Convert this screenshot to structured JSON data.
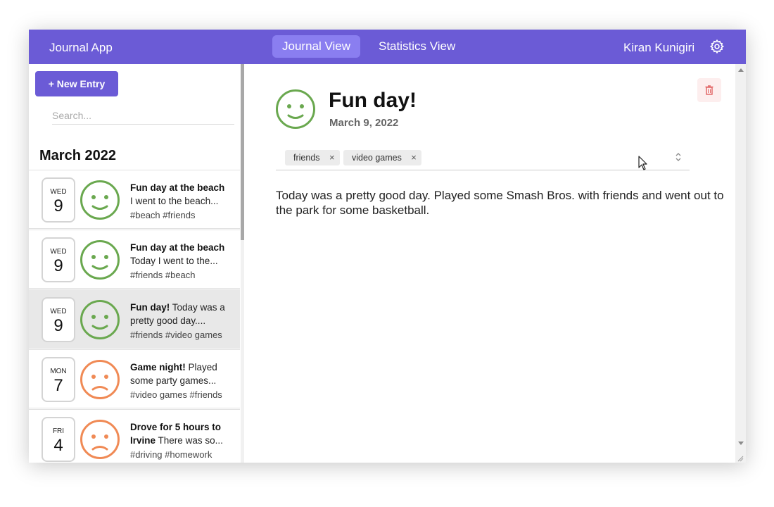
{
  "header": {
    "app_title": "Journal App",
    "tabs": [
      {
        "label": "Journal View",
        "active": true
      },
      {
        "label": "Statistics View",
        "active": false
      }
    ],
    "user_name": "Kiran Kunigiri",
    "accent_color": "#6b5bd6",
    "settings_icon": "gear-icon"
  },
  "sidebar": {
    "new_entry_label": "+ New Entry",
    "search_placeholder": "Search...",
    "month_label": "March 2022",
    "entries": [
      {
        "dow": "WED",
        "day": "9",
        "mood": "happy",
        "title": "Fun day at the beach",
        "preview": "I went to the beach...",
        "tags": "#beach #friends",
        "selected": false
      },
      {
        "dow": "WED",
        "day": "9",
        "mood": "happy",
        "title": "Fun day at the beach",
        "preview": "Today I went to the...",
        "tags": "#friends #beach",
        "selected": false
      },
      {
        "dow": "WED",
        "day": "9",
        "mood": "happy",
        "title": "Fun day!",
        "preview_inline": "Today was a",
        "preview": "pretty good day....",
        "tags": "#friends #video games",
        "selected": true
      },
      {
        "dow": "MON",
        "day": "7",
        "mood": "sad",
        "title": "Game night!",
        "preview_inline": "Played",
        "preview": "some party games...",
        "tags": "#video games #friends",
        "selected": false
      },
      {
        "dow": "FRI",
        "day": "4",
        "mood": "sad",
        "title_line1": "Drove for 5 hours to",
        "title_line2": "Irvine",
        "preview_inline": "There was so...",
        "tags": "#driving #homework",
        "selected": false
      }
    ]
  },
  "main": {
    "title": "Fun day!",
    "date": "March 9, 2022",
    "mood": "happy",
    "tags": [
      {
        "label": "friends",
        "remove": "×"
      },
      {
        "label": "video games",
        "remove": "×"
      }
    ],
    "body": "Today was a pretty good day. Played some Smash Bros. with friends and went out to the park for some basketball.",
    "delete_icon": "trash-icon"
  },
  "colors": {
    "happy": "#6aa84f",
    "sad": "#f08a55",
    "delete": "#e06060"
  }
}
